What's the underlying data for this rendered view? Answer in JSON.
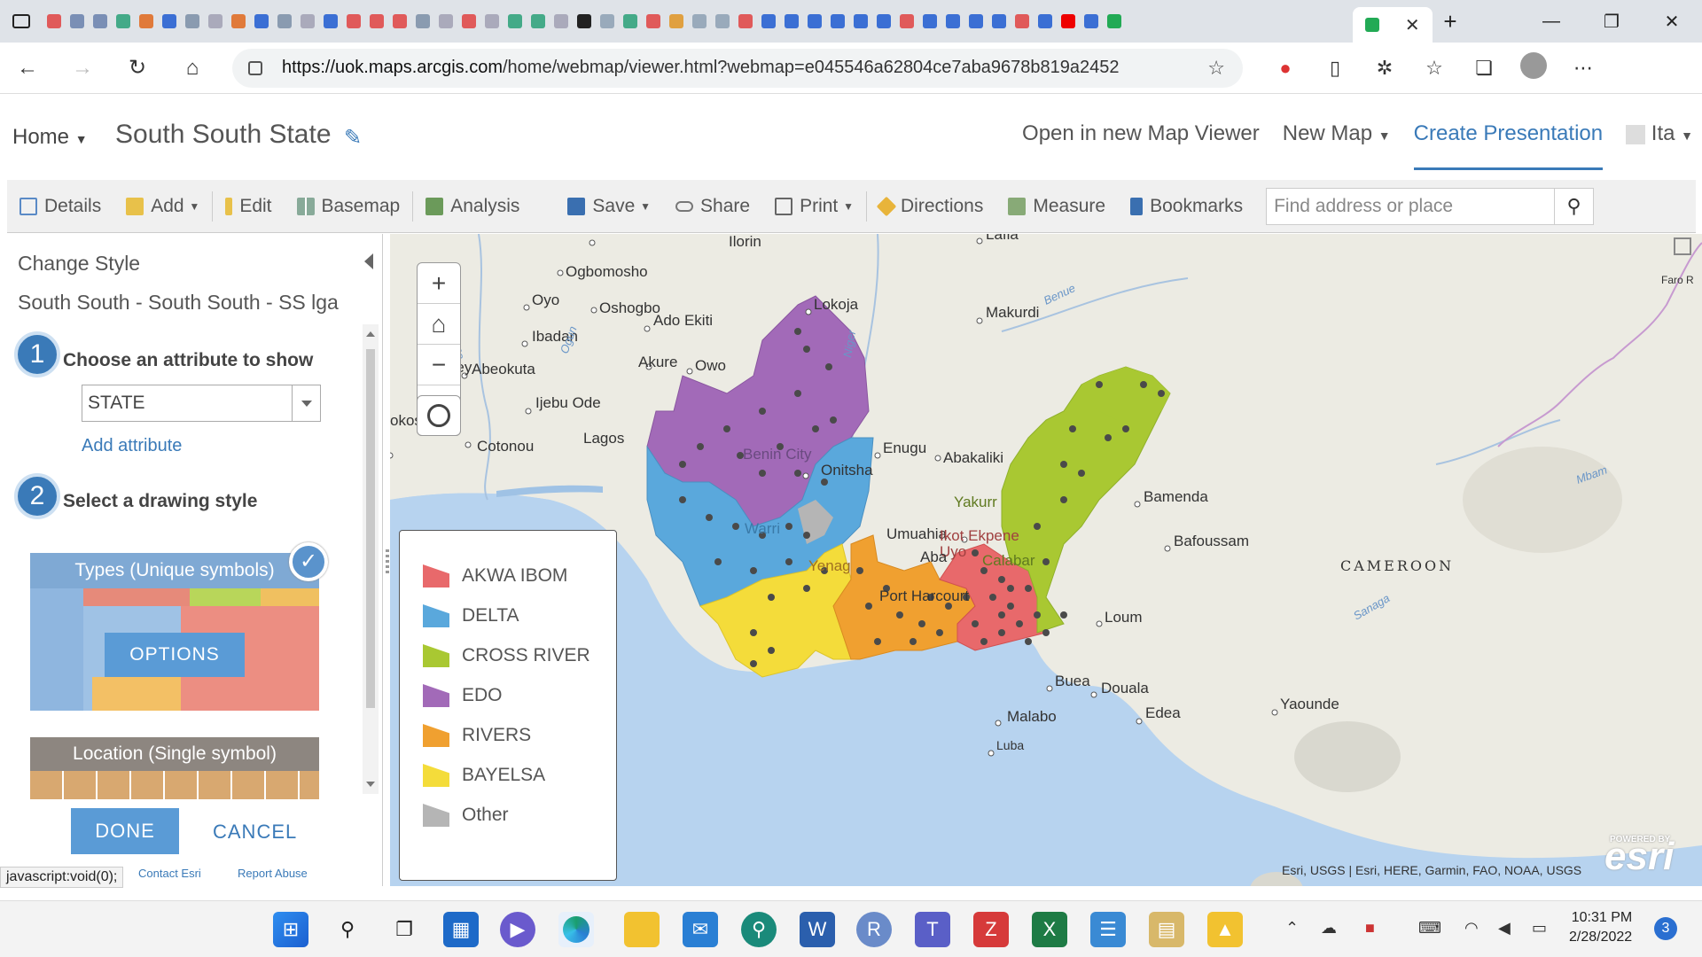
{
  "browser": {
    "url_host": "https://uok.maps.arcgis.com",
    "url_path": "/home/webmap/viewer.html?webmap=e045546a62804ce7aba9678b819a2452",
    "tab_icon_colors": [
      "#e05a5a",
      "#7a8fb5",
      "#7a8fb5",
      "#4a8",
      "#e07a3a",
      "#3b6fd4",
      "#8a9bb0",
      "#aab",
      "#e07a3a",
      "#3b6fd4",
      "#8a9bb0",
      "#aab",
      "#3b6fd4",
      "#e05a5a",
      "#e05a5a",
      "#e05a5a",
      "#8a9bb0",
      "#aab",
      "#e05a5a",
      "#aab",
      "#4a8",
      "#4a8",
      "#aab",
      "#222",
      "#9ab",
      "#4a8",
      "#e05a5a",
      "#e0a040",
      "#9ab",
      "#9ab",
      "#e05a5a",
      "#3b6fd4",
      "#3b6fd4",
      "#3b6fd4",
      "#3b6fd4",
      "#3b6fd4",
      "#3b6fd4",
      "#e05a5a",
      "#3b6fd4",
      "#3b6fd4",
      "#3b6fd4",
      "#3b6fd4",
      "#e05a5a",
      "#3b6fd4",
      "#e00",
      "#3b6fd4",
      "#2a5"
    ]
  },
  "app": {
    "home_label": "Home",
    "map_title": "South South State",
    "open_new_viewer": "Open in new Map Viewer",
    "new_map": "New Map",
    "create_presentation": "Create Presentation",
    "user": "Ita"
  },
  "toolbar": {
    "details": "Details",
    "add": "Add",
    "edit": "Edit",
    "basemap": "Basemap",
    "analysis": "Analysis",
    "save": "Save",
    "share": "Share",
    "print": "Print",
    "directions": "Directions",
    "measure": "Measure",
    "bookmarks": "Bookmarks",
    "search_placeholder": "Find address or place"
  },
  "panel": {
    "title": "Change Style",
    "layer": "South South - South South - SS lga",
    "step1_num": "1",
    "step1_label": "Choose an attribute to show",
    "attribute_value": "STATE",
    "add_attribute": "Add attribute",
    "step2_num": "2",
    "step2_label": "Select a drawing style",
    "style1_title": "Types (Unique symbols)",
    "style1_options": "OPTIONS",
    "style2_title": "Location (Single symbol)",
    "done": "DONE",
    "cancel": "CANCEL",
    "footer_contact": "Contact Esri",
    "footer_report": "Report Abuse",
    "status_url": "javascript:void(0);"
  },
  "legend": [
    {
      "label": "AKWA IBOM",
      "color": "#e8696b"
    },
    {
      "label": "DELTA",
      "color": "#5aa8dc"
    },
    {
      "label": "CROSS RIVER",
      "color": "#a9c832"
    },
    {
      "label": "EDO",
      "color": "#a26ab8"
    },
    {
      "label": "RIVERS",
      "color": "#f0a030"
    },
    {
      "label": "BAYELSA",
      "color": "#f4dc3a"
    },
    {
      "label": "Other",
      "color": "#b5b5b5"
    }
  ],
  "map_labels": {
    "ilorin": "Ilorin",
    "ogbomosho": "Ogbomosho",
    "oyo": "Oyo",
    "oshogbo": "Oshogbo",
    "ibadan": "Ibadan",
    "abeokuta": "Abeokuta",
    "ado_ekiti": "Ado Ekiti",
    "akure": "Akure",
    "owo": "Owo",
    "lokoja": "Lokoja",
    "makurdi": "Makurdi",
    "lafia": "Lafia",
    "ijebu_ode": "Ijebu Ode",
    "lagos": "Lagos",
    "cotonou": "Cotonou",
    "pokossa": "okossa",
    "abomey": "Abomey",
    "benin_city": "Benin City",
    "onitsha": "Onitsha",
    "enugu": "Enugu",
    "abakaliki": "Abakaliki",
    "warri": "Warri",
    "umuahia": "Umuahia",
    "ikot_ekpene": "Ikot Ekpene",
    "uyo": "Uyo",
    "calabar": "Calabar",
    "yakurr": "Yakurr",
    "yenagoa": "Yenag",
    "port_harcourt": "Port Harcourt",
    "aba": "Aba",
    "bamenda": "Bamenda",
    "bafoussam": "Bafoussam",
    "cameroon": "CAMEROON",
    "loum": "Loum",
    "buea": "Buea",
    "douala": "Douala",
    "malabo": "Malabo",
    "edea": "Edea",
    "yaounde": "Yaounde",
    "luba": "Luba",
    "faro": "Faro R",
    "benue": "Benue",
    "niger": "Niger",
    "ogun": "Ogun",
    "oueme": "Queme",
    "mbam": "Mbam",
    "sanaga": "Sanaga"
  },
  "map": {
    "attribution": "Esri, USGS | Esri, HERE, Garmin, FAO, NOAA, USGS",
    "esri_logo": "esri",
    "esri_powered": "POWERED BY"
  },
  "taskbar": {
    "time": "10:31 PM",
    "date": "2/28/2022",
    "notifications": "3"
  }
}
